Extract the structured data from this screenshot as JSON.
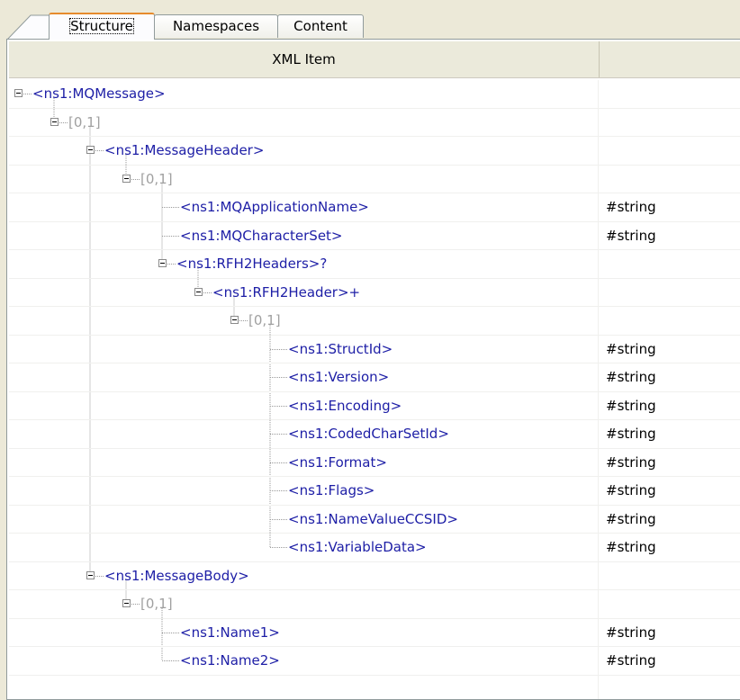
{
  "tabs": [
    {
      "label": "Structure",
      "active": true
    },
    {
      "label": "Namespaces",
      "active": false
    },
    {
      "label": "Content",
      "active": false
    }
  ],
  "table": {
    "columns": [
      "XML Item",
      ""
    ],
    "rows": [
      {
        "text": "<ns1:MQMessage>",
        "kind": "elem",
        "level": 0,
        "expander": true,
        "value": ""
      },
      {
        "text": "[0,1]",
        "kind": "card",
        "level": 1,
        "expander": true,
        "value": ""
      },
      {
        "text": "<ns1:MessageHeader>",
        "kind": "elem",
        "level": 2,
        "expander": true,
        "value": ""
      },
      {
        "text": "[0,1]",
        "kind": "card",
        "level": 3,
        "expander": true,
        "value": ""
      },
      {
        "text": "<ns1:MQApplicationName>",
        "kind": "elem",
        "level": 4,
        "expander": false,
        "value": "#string"
      },
      {
        "text": "<ns1:MQCharacterSet>",
        "kind": "elem",
        "level": 4,
        "expander": false,
        "value": "#string"
      },
      {
        "text": "<ns1:RFH2Headers>?",
        "kind": "elem",
        "level": 4,
        "expander": true,
        "value": ""
      },
      {
        "text": "<ns1:RFH2Header>+",
        "kind": "elem",
        "level": 5,
        "expander": true,
        "value": ""
      },
      {
        "text": "[0,1]",
        "kind": "card",
        "level": 6,
        "expander": true,
        "value": ""
      },
      {
        "text": "<ns1:StructId>",
        "kind": "elem",
        "level": 7,
        "expander": false,
        "value": "#string"
      },
      {
        "text": "<ns1:Version>",
        "kind": "elem",
        "level": 7,
        "expander": false,
        "value": "#string"
      },
      {
        "text": "<ns1:Encoding>",
        "kind": "elem",
        "level": 7,
        "expander": false,
        "value": "#string"
      },
      {
        "text": "<ns1:CodedCharSetId>",
        "kind": "elem",
        "level": 7,
        "expander": false,
        "value": "#string"
      },
      {
        "text": "<ns1:Format>",
        "kind": "elem",
        "level": 7,
        "expander": false,
        "value": "#string"
      },
      {
        "text": "<ns1:Flags>",
        "kind": "elem",
        "level": 7,
        "expander": false,
        "value": "#string"
      },
      {
        "text": "<ns1:NameValueCCSID>",
        "kind": "elem",
        "level": 7,
        "expander": false,
        "value": "#string"
      },
      {
        "text": "<ns1:VariableData>",
        "kind": "elem",
        "level": 7,
        "expander": false,
        "value": "#string"
      },
      {
        "text": "<ns1:MessageBody>",
        "kind": "elem",
        "level": 2,
        "expander": true,
        "value": ""
      },
      {
        "text": "[0,1]",
        "kind": "card",
        "level": 3,
        "expander": true,
        "value": ""
      },
      {
        "text": "<ns1:Name1>",
        "kind": "elem",
        "level": 4,
        "expander": false,
        "value": "#string"
      },
      {
        "text": "<ns1:Name2>",
        "kind": "elem",
        "level": 4,
        "expander": false,
        "value": "#string"
      }
    ]
  }
}
